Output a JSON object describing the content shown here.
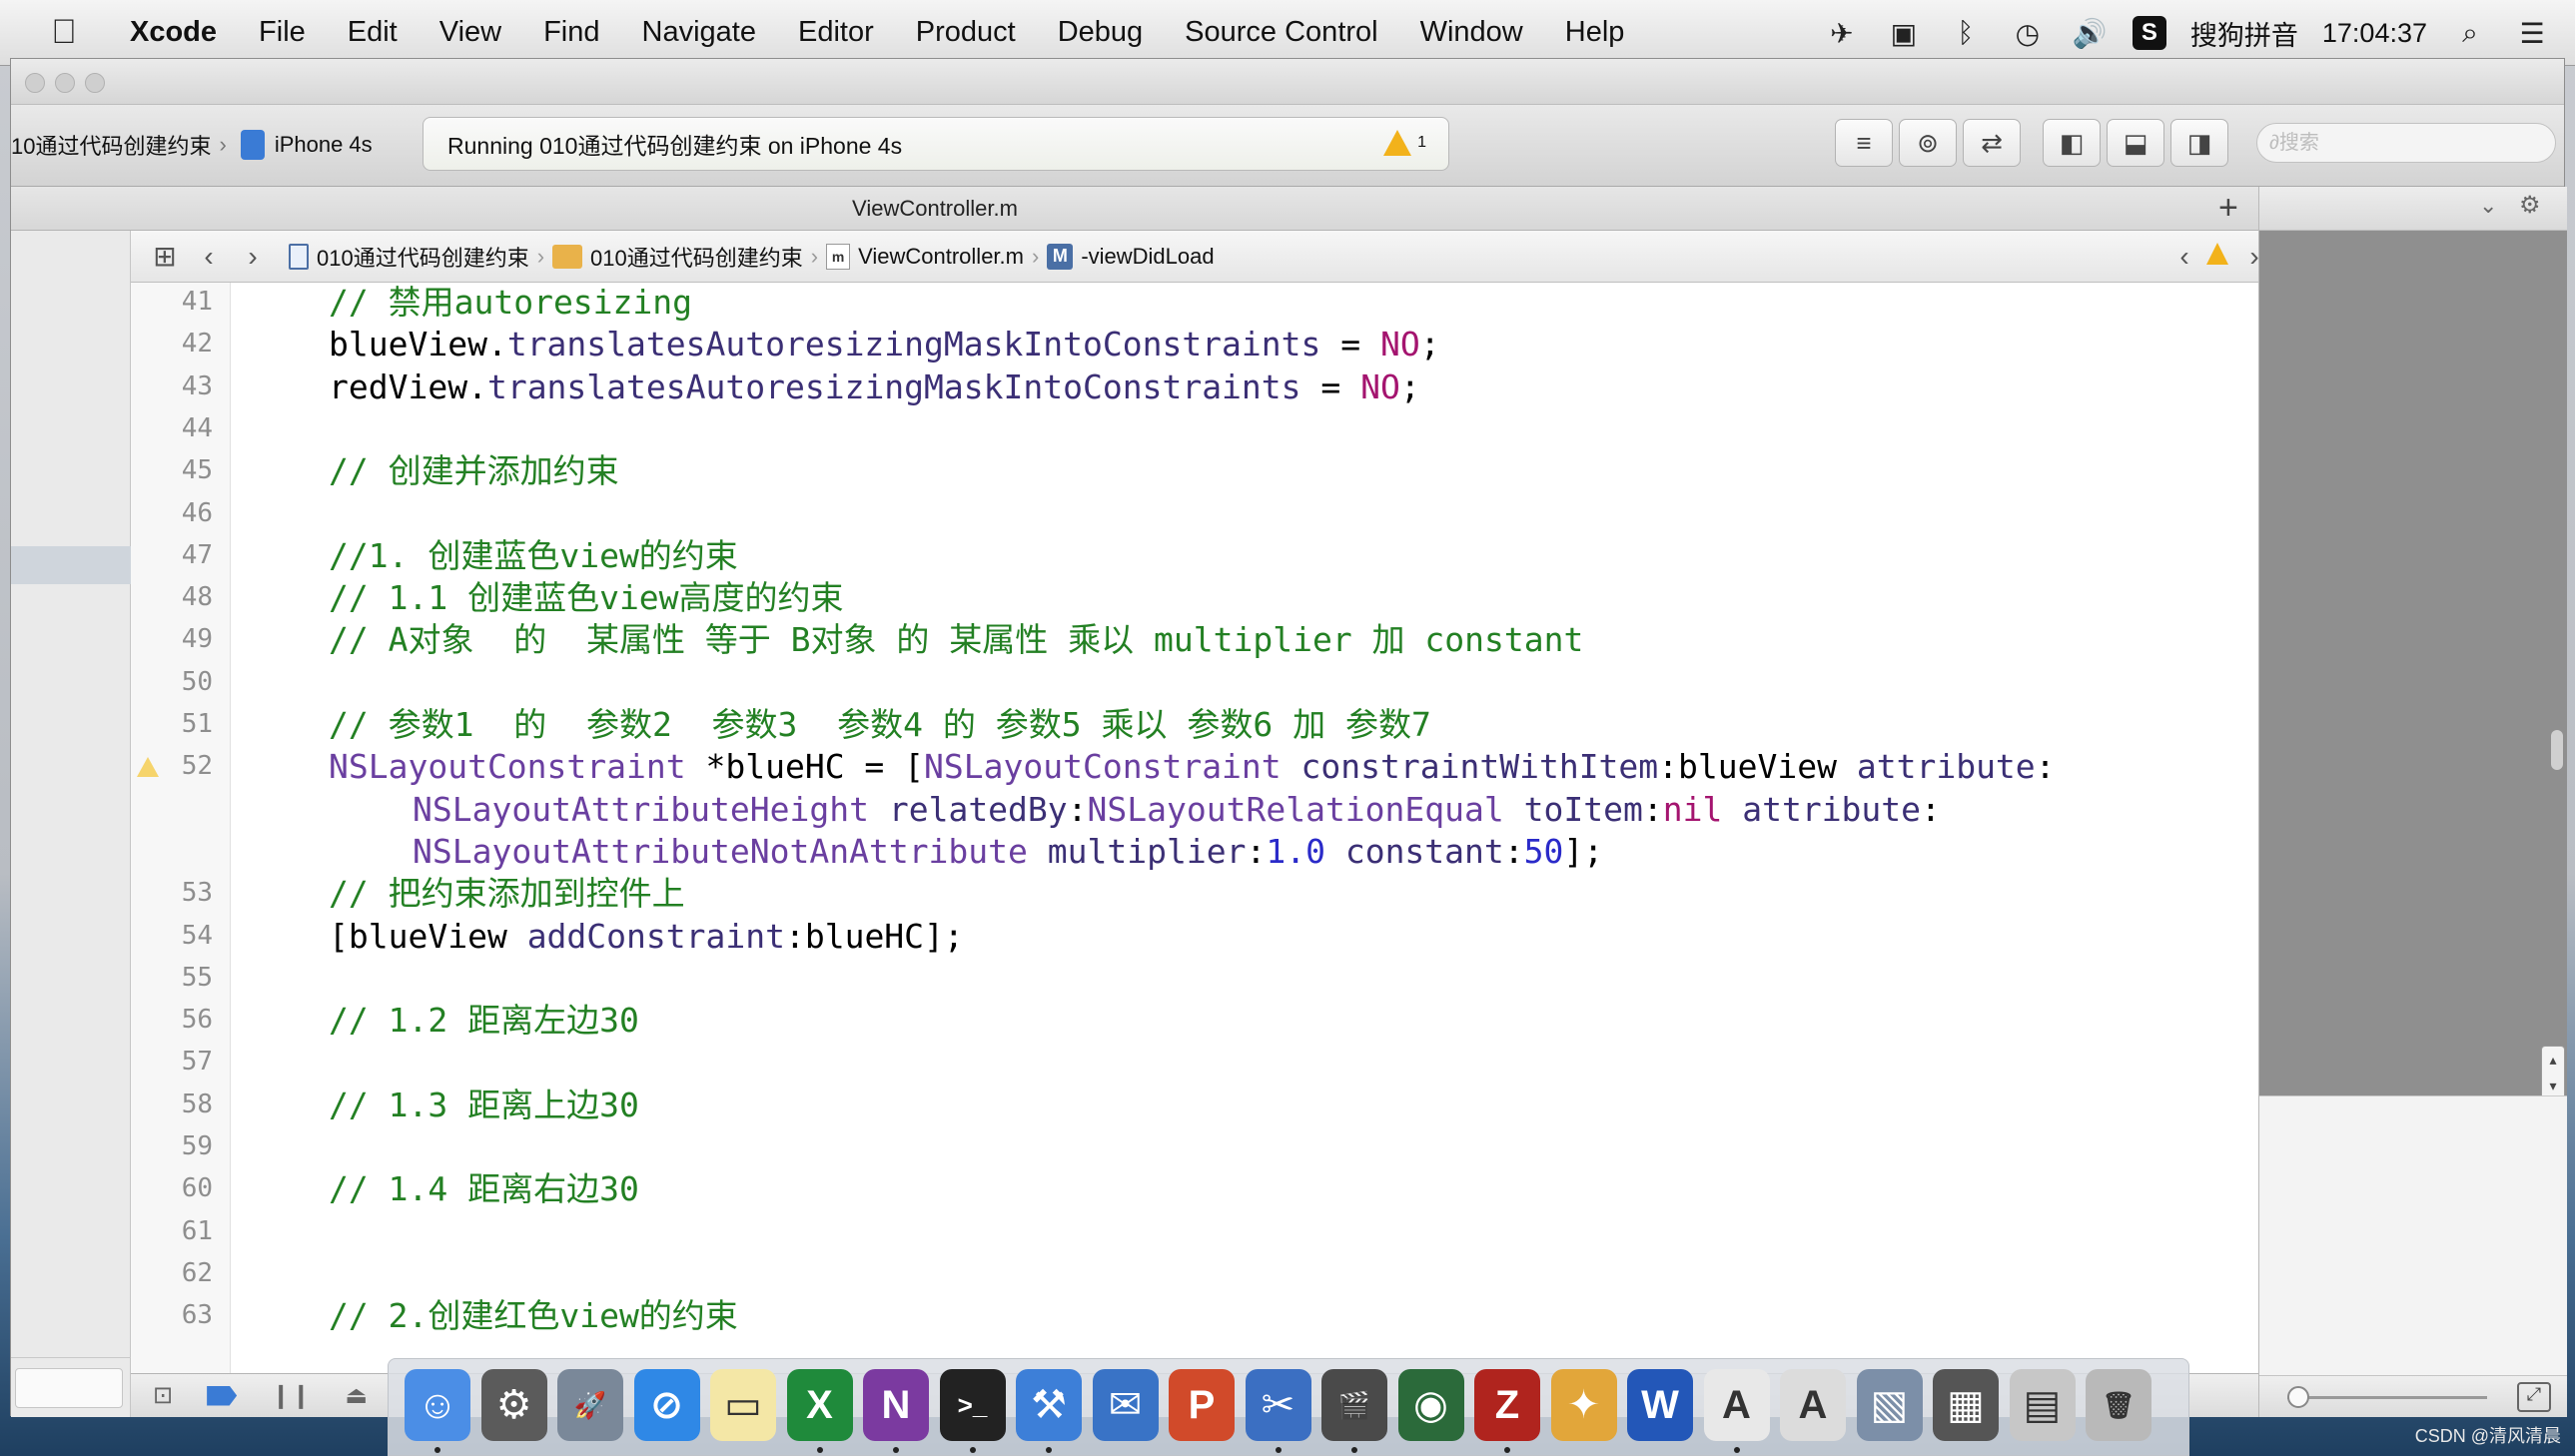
{
  "menubar": {
    "app": "Xcode",
    "items": [
      "File",
      "Edit",
      "View",
      "Find",
      "Navigate",
      "Editor",
      "Product",
      "Debug",
      "Source Control",
      "Window",
      "Help"
    ],
    "input_method": "搜狗拼音",
    "clock": "17:04:37"
  },
  "toolbar": {
    "scheme": "10通过代码创建约束",
    "device": "iPhone 4s",
    "activity": "Running 010通过代码创建约束 on iPhone 4s",
    "warning_count": "1",
    "search_placeholder": "∂搜索"
  },
  "tab": {
    "title": "ViewController.m",
    "add": "+"
  },
  "jumpbar": {
    "crumbs": [
      "010通过代码创建约束",
      "010通过代码创建约束",
      "ViewController.m",
      "-viewDidLoad"
    ]
  },
  "editor": {
    "lines": [
      {
        "num": "41",
        "text": "// 禁用autoresizing",
        "kind": "comment"
      },
      {
        "num": "42",
        "text": "blueView.translatesAutoresizingMaskIntoConstraints = NO;",
        "kind": "code"
      },
      {
        "num": "43",
        "text": "redView.translatesAutoresizingMaskIntoConstraints = NO;",
        "kind": "code"
      },
      {
        "num": "44",
        "text": "",
        "kind": "code"
      },
      {
        "num": "45",
        "text": "// 创建并添加约束",
        "kind": "comment"
      },
      {
        "num": "46",
        "text": "",
        "kind": "code"
      },
      {
        "num": "47",
        "text": "//1. 创建蓝色view的约束",
        "kind": "comment"
      },
      {
        "num": "48",
        "text": "// 1.1 创建蓝色view高度的约束",
        "kind": "comment"
      },
      {
        "num": "49",
        "text": "// A对象  的  某属性 等于 B对象 的 某属性 乘以 multiplier 加 constant",
        "kind": "comment"
      },
      {
        "num": "50",
        "text": "",
        "kind": "code"
      },
      {
        "num": "51",
        "text": "// 参数1  的  参数2  参数3  参数4 的 参数5 乘以 参数6 加 参数7",
        "kind": "comment"
      },
      {
        "num": "52",
        "text": "NSLayoutConstraint *blueHC = [NSLayoutConstraint constraintWithItem:blueView attribute:",
        "kind": "code",
        "warning": true
      },
      {
        "num": "",
        "text": "NSLayoutAttributeHeight relatedBy:NSLayoutRelationEqual toItem:nil attribute:",
        "kind": "cont"
      },
      {
        "num": "",
        "text": "NSLayoutAttributeNotAnAttribute multiplier:1.0 constant:50];",
        "kind": "cont"
      },
      {
        "num": "53",
        "text": "// 把约束添加到控件上",
        "kind": "comment"
      },
      {
        "num": "54",
        "text": "[blueView addConstraint:blueHC];",
        "kind": "code"
      },
      {
        "num": "55",
        "text": "",
        "kind": "code"
      },
      {
        "num": "56",
        "text": "// 1.2 距离左边30",
        "kind": "comment"
      },
      {
        "num": "57",
        "text": "",
        "kind": "code"
      },
      {
        "num": "58",
        "text": "// 1.3 距离上边30",
        "kind": "comment"
      },
      {
        "num": "59",
        "text": "",
        "kind": "code"
      },
      {
        "num": "60",
        "text": "// 1.4 距离右边30",
        "kind": "comment"
      },
      {
        "num": "61",
        "text": "",
        "kind": "code"
      },
      {
        "num": "62",
        "text": "",
        "kind": "code"
      },
      {
        "num": "63",
        "text": "// 2.创建红色view的约束",
        "kind": "comment"
      }
    ]
  },
  "colors": {
    "comment": "#238023",
    "class": "#6a3fa0",
    "keyword": "#a4146f",
    "number": "#2a2ac9",
    "warning": "#f2b21b"
  },
  "dock": {
    "icons": [
      "finder-icon",
      "system-preferences-icon",
      "launchpad-icon",
      "safari-icon",
      "notes-icon",
      "excel-icon",
      "onenote-icon",
      "terminal-icon",
      "xcode-icon",
      "mail-icon",
      "powerpoint-icon",
      "instruments-icon",
      "final-cut-icon",
      "globe-icon",
      "filezilla-icon",
      "toolbox-icon",
      "word-icon",
      "textedit-icon",
      "font-book-icon",
      "preview-icon",
      "disk-icon",
      "server-icon",
      "trash-icon"
    ]
  },
  "watermark": "CSDN @清风清晨"
}
